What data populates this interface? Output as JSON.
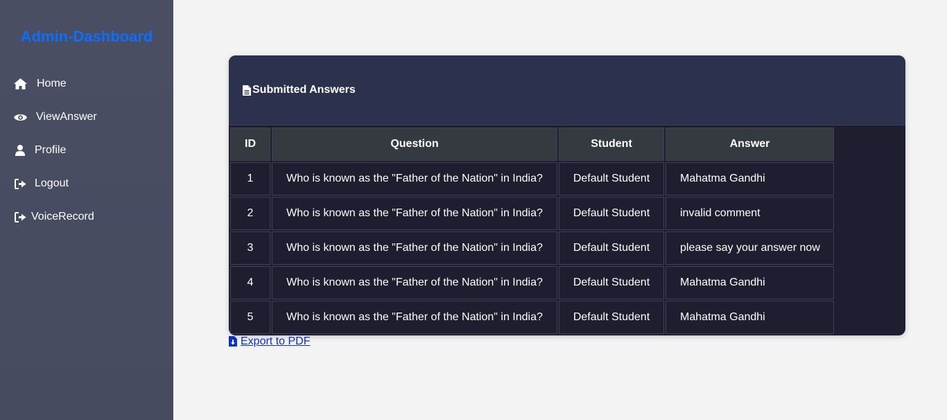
{
  "sidebar": {
    "brand": "Admin-Dashboard",
    "items": [
      {
        "label": "Home",
        "icon": "home-icon"
      },
      {
        "label": "ViewAnswer",
        "icon": "eye-icon"
      },
      {
        "label": "Profile",
        "icon": "user-icon"
      },
      {
        "label": "Logout",
        "icon": "sign-out-icon"
      },
      {
        "label": "VoiceRecord",
        "icon": "sign-out-icon"
      }
    ]
  },
  "card": {
    "title": "Submitted Answers",
    "icon": "file-icon",
    "columns": [
      "ID",
      "Question",
      "Student",
      "Answer"
    ],
    "rows": [
      {
        "id": "1",
        "question": "Who is known as the \"Father of the Nation\" in India?",
        "student": "Default Student",
        "answer": "Mahatma Gandhi"
      },
      {
        "id": "2",
        "question": "Who is known as the \"Father of the Nation\" in India?",
        "student": "Default Student",
        "answer": "invalid comment"
      },
      {
        "id": "3",
        "question": "Who is known as the \"Father of the Nation\" in India?",
        "student": "Default Student",
        "answer": "please say your answer now"
      },
      {
        "id": "4",
        "question": "Who is known as the \"Father of the Nation\" in India?",
        "student": "Default Student",
        "answer": "Mahatma Gandhi"
      },
      {
        "id": "5",
        "question": "Who is known as the \"Father of the Nation\" in India?",
        "student": "Default Student",
        "answer": "Mahatma Gandhi"
      }
    ]
  },
  "export": {
    "label": "Export to PDF",
    "icon": "file-download-icon"
  },
  "colors": {
    "brand": "#0d6efd",
    "sidebar_bg": "#4a4e63",
    "card_bg": "#1f1d30",
    "card_header_bg": "#2c314d",
    "table_header_bg": "#343a40",
    "link": "#0d2fd0"
  }
}
